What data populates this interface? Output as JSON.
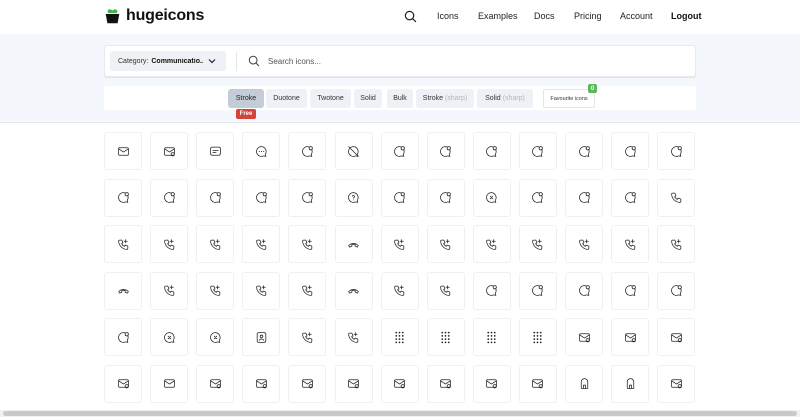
{
  "nav": {
    "brand": "hugeicons",
    "items": [
      "Icons",
      "Examples",
      "Docs",
      "Pricing",
      "Account"
    ],
    "logout": "Logout"
  },
  "search": {
    "category_label": "Category:",
    "category_value": "Communicatio...",
    "placeholder": "Search icons..."
  },
  "styles": {
    "tabs": [
      {
        "label": "Stroke",
        "sharp": ""
      },
      {
        "label": "Duotone",
        "sharp": ""
      },
      {
        "label": "Twotone",
        "sharp": ""
      },
      {
        "label": "Solid",
        "sharp": ""
      },
      {
        "label": "Bulk",
        "sharp": ""
      },
      {
        "label": "Stroke",
        "sharp": "(sharp)"
      },
      {
        "label": "Solid",
        "sharp": "(sharp)"
      }
    ],
    "active_index": 0,
    "free_badge": "Free",
    "favourite_label": "Favourite icons",
    "favourite_count": "0"
  },
  "colors": {
    "accent_free": "#d64339",
    "accent_count": "#5cb85c",
    "active_tab": "#c4ccd7"
  },
  "icons": [
    [
      "mail-icon",
      "mail-open-icon",
      "message-text-icon",
      "chat-dots-icon",
      "chat-add-icon",
      "chat-off-icon",
      "chat-lightning-icon",
      "chat-notification-icon",
      "chat-check-icon",
      "chat-minus-icon",
      "chat-lightning-icon",
      "chat-edit-icon",
      "chat-notification-icon"
    ],
    [
      "chat-add-icon",
      "chat-notification-icon",
      "chat-notification-icon",
      "chat-add-icon",
      "chat-notification-icon",
      "chat-question-icon",
      "chat-notification-icon",
      "chat-notification-icon",
      "chat-close-icon",
      "chat-notification-icon",
      "chat-add-icon",
      "chat-notification-icon",
      "phone-icon"
    ],
    [
      "phone-add-icon",
      "phone-location-icon",
      "phone-off-icon",
      "phone-check-icon",
      "phone-close-icon",
      "phone-hangup-icon",
      "phone-transfer-icon",
      "phone-incoming-icon",
      "phone-wifi-icon",
      "phone-forward-icon",
      "phone-user-icon",
      "phone-minus-icon",
      "phone-missed-icon"
    ],
    [
      "phone-hangup-icon",
      "phone-forward-icon",
      "phone-outgoing-icon",
      "phone-pause-icon",
      "phone-reply-icon",
      "phone-hangup-icon",
      "phone-blocked-icon",
      "phone-lock-icon",
      "chat-search-icon",
      "chat-icon",
      "chat-add-icon",
      "chat-add-icon",
      "chat-notification-icon"
    ],
    [
      "chat-notification-icon",
      "chat-close-icon",
      "chat-close-icon",
      "contact-book-icon",
      "phone-book-icon",
      "phone-settings-icon",
      "dial-pad-icon",
      "dial-pad-icon",
      "dial-pad-icon",
      "dial-pad-icon",
      "inbox-notification-icon",
      "inbox-download-icon",
      "inbox-notification-icon"
    ],
    [
      "inbox-download-icon",
      "mail-icon",
      "mail-settings-icon",
      "mail-user-icon",
      "mail-add-icon",
      "mail-edit-icon",
      "mail-block-icon",
      "mail-image-icon",
      "mail-lock-icon",
      "mail-check-icon",
      "mailbox-icon",
      "mailbox-flag-icon",
      "mail-send-icon"
    ]
  ]
}
